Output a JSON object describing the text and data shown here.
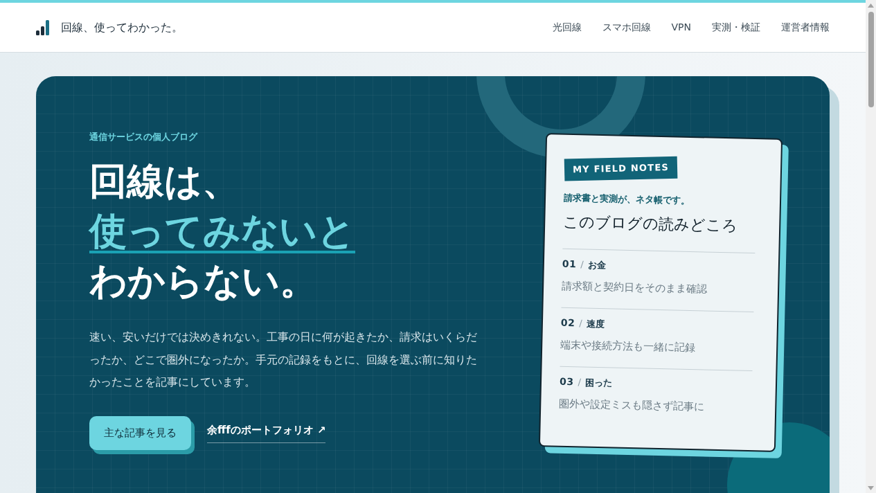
{
  "header": {
    "brand": "回線、使ってわかった。",
    "nav": [
      "光回線",
      "スマホ回線",
      "VPN",
      "実測・検証",
      "運営者情報"
    ]
  },
  "hero": {
    "eyebrow": "通信サービスの個人ブログ",
    "headline": [
      {
        "text": "回線は、",
        "kind": "plain"
      },
      {
        "text": "使ってみないと",
        "kind": "accent"
      },
      {
        "text": "わからない。",
        "kind": "plain"
      }
    ],
    "lead": "速い、安いだけでは決めきれない。工事の日に何が起きたか、請求はいくらだったか、どこで圏外になったか。手元の記録をもとに、回線を選ぶ前に知りたかったことを記事にしています。",
    "actions": [
      {
        "label": "主な記事を見る",
        "kind": "button"
      },
      {
        "label": "余fffのポートフォリオ ↗",
        "kind": "link"
      }
    ]
  },
  "notes_card": {
    "tag": "MY FIELD NOTES",
    "subtitle": "請求書と実測が、ネタ帳です。",
    "title": "このブログの読みどころ",
    "items": [
      {
        "number": "01",
        "separator": "/",
        "topic": "お金",
        "description": "請求額と契約日をそのまま確認"
      },
      {
        "number": "02",
        "separator": "/",
        "topic": "速度",
        "description": "端末や接続方法も一緒に記録"
      },
      {
        "number": "03",
        "separator": "/",
        "topic": "困った",
        "description": "圏外や設定ミスも隠さず記事に"
      }
    ]
  }
}
